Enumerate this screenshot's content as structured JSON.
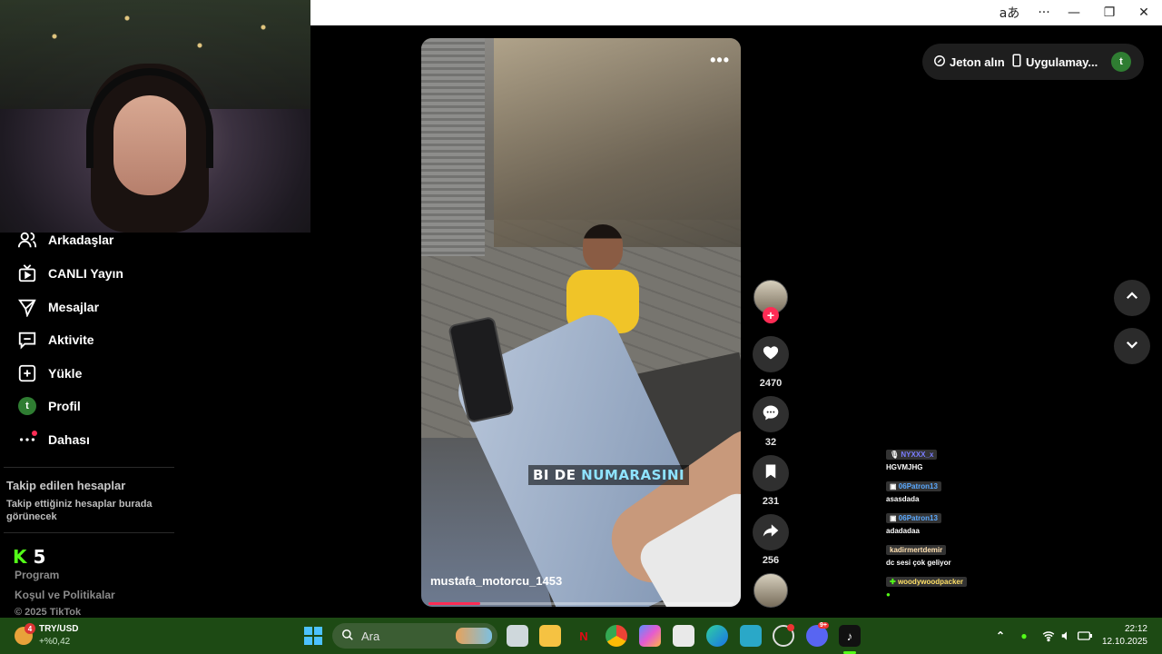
{
  "window": {
    "translate_glyph": "aあ",
    "more_glyph": "···",
    "minimize_glyph": "—",
    "restore_glyph": "❐",
    "close_glyph": "✕"
  },
  "sidebar": {
    "items": [
      {
        "label": "Arkadaşlar",
        "icon": "friends-icon"
      },
      {
        "label": "CANLI Yayın",
        "icon": "live-tv-icon"
      },
      {
        "label": "Mesajlar",
        "icon": "messages-icon"
      },
      {
        "label": "Aktivite",
        "icon": "activity-icon"
      },
      {
        "label": "Yükle",
        "icon": "upload-icon"
      },
      {
        "label": "Profil",
        "icon": "profile-avatar",
        "avatar_letter": "t"
      },
      {
        "label": "Dahası",
        "icon": "more-icon"
      }
    ],
    "followed_title": "Takip edilen hesaplar",
    "followed_desc": "Takip ettiğiniz hesaplar burada görünecek",
    "logo_text": "K 5",
    "footer": [
      "Program",
      "Koşul ve Politikalar",
      "© 2025 TikTok"
    ]
  },
  "video": {
    "menu_glyph": "•••",
    "caption_part1": "BI DE ",
    "caption_part2": "NUMARASINI",
    "author": "mustafa_motorcu_1453",
    "progress_percent": 17
  },
  "actions": {
    "follow_plus": "+",
    "likes": "2470",
    "comments": "32",
    "saves": "231",
    "shares": "256"
  },
  "topbar": {
    "coins_label": "Jeton alın",
    "app_label": "Uygulamay...",
    "avatar_letter": "t"
  },
  "chat": [
    {
      "user": "NYXXX_x",
      "text": "HGVMJHG",
      "color": "#7a7dff",
      "badge": "🎙"
    },
    {
      "user": "06Patron13",
      "text": "asasdada",
      "color": "#5aa9ff",
      "badge": "▣"
    },
    {
      "user": "06Patron13",
      "text": "adadadaa",
      "color": "#5aa9ff",
      "badge": "▣"
    },
    {
      "user": "kadirmertdemir",
      "text": "dc sesi çok geliyor",
      "color": "#ffe0b0",
      "badge": ""
    },
    {
      "user": "woodywoodpacker",
      "text": "●",
      "color": "#ffe066",
      "badge": "✚"
    }
  ],
  "taskbar": {
    "ticker_badge": "4",
    "ticker_pair": "TRY/USD",
    "ticker_change": "+%0,42",
    "search_label": "Ara",
    "discord_badge": "9+",
    "time": "22:12",
    "date": "12.10.2025"
  },
  "colors": {
    "accent_pink": "#fe2c55",
    "taskbar_green": "#1d4a14",
    "profile_green": "#2f7d32"
  }
}
